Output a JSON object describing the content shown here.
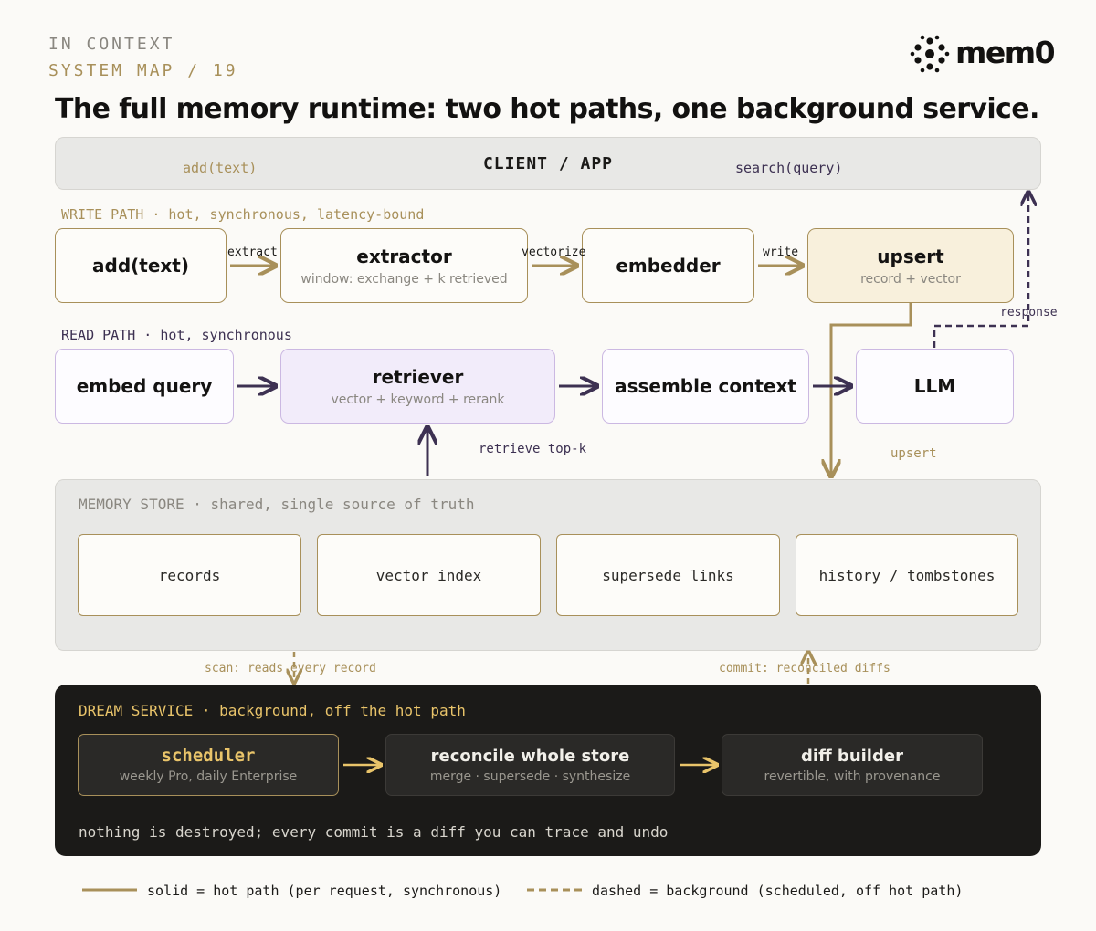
{
  "header": {
    "kicker_line1": "IN CONTEXT",
    "kicker_line2": "SYSTEM MAP / 19",
    "headline": "The full memory runtime: two hot paths, one background service.",
    "logo_text": "mem0"
  },
  "client": {
    "title": "CLIENT / APP",
    "left_call": "add(text)",
    "right_call": "search(query)"
  },
  "write_path": {
    "label": "WRITE PATH · hot, synchronous, latency-bound",
    "nodes": [
      {
        "title": "add(text)",
        "sub": ""
      },
      {
        "title": "extractor",
        "sub": "window: exchange + k retrieved"
      },
      {
        "title": "embedder",
        "sub": ""
      },
      {
        "title": "upsert",
        "sub": "record + vector"
      }
    ],
    "edges": [
      "extract",
      "vectorize",
      "write"
    ]
  },
  "read_path": {
    "label": "READ PATH · hot, synchronous",
    "nodes": [
      {
        "title": "embed query",
        "sub": ""
      },
      {
        "title": "retriever",
        "sub": "vector + keyword + rerank"
      },
      {
        "title": "assemble context",
        "sub": ""
      },
      {
        "title": "LLM",
        "sub": ""
      }
    ],
    "response_label": "response",
    "retrieve_label": "retrieve top-k",
    "upsert_label": "upsert"
  },
  "memory_store": {
    "label": "MEMORY STORE · shared, single source of truth",
    "items": [
      "records",
      "vector index",
      "supersede links",
      "history / tombstones"
    ],
    "scan_label": "scan: reads every record",
    "commit_label": "commit: reconciled diffs"
  },
  "dream_service": {
    "label": "DREAM SERVICE · background, off the hot path",
    "nodes": [
      {
        "title": "scheduler",
        "sub": "weekly Pro, daily Enterprise"
      },
      {
        "title": "reconcile whole store",
        "sub": "merge · supersede · synthesize"
      },
      {
        "title": "diff builder",
        "sub": "revertible, with provenance"
      }
    ],
    "footer": "nothing is destroyed; every commit is a diff you can trace and undo"
  },
  "legend": {
    "solid": "solid = hot path (per request, synchronous)",
    "dashed": "dashed = background (scheduled, off hot path)"
  },
  "colors": {
    "gold": "#a8905a",
    "purple": "#3d3152",
    "dream_bg": "#1b1a18",
    "scheduler_accent": "#e9c46a"
  },
  "icons": {
    "logo": "mem0-dot-cluster-icon"
  }
}
